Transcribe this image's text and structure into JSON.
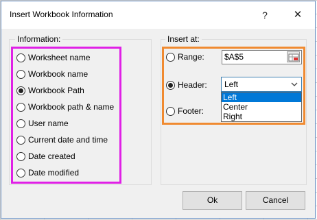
{
  "dialog": {
    "title": "Insert Workbook Information",
    "help_label": "?",
    "close_label": "✕"
  },
  "information": {
    "caption": "Information:",
    "options": [
      {
        "label": "Worksheet name",
        "checked": false
      },
      {
        "label": "Workbook name",
        "checked": false
      },
      {
        "label": "Workbook Path",
        "checked": true
      },
      {
        "label": "Workbook path & name",
        "checked": false
      },
      {
        "label": "User name",
        "checked": false
      },
      {
        "label": "Current date and time",
        "checked": false
      },
      {
        "label": "Date created",
        "checked": false
      },
      {
        "label": "Date modified",
        "checked": false
      }
    ]
  },
  "insert_at": {
    "caption": "Insert at:",
    "range": {
      "label": "Range:",
      "value": "$A$5",
      "checked": false
    },
    "header": {
      "label": "Header:",
      "checked": true,
      "selected": "Left",
      "options": [
        "Left",
        "Center",
        "Right"
      ]
    },
    "footer": {
      "label": "Footer:",
      "checked": false
    }
  },
  "buttons": {
    "ok": "Ok",
    "cancel": "Cancel"
  },
  "colors": {
    "info_highlight": "#e020e6",
    "insert_highlight": "#f08a30",
    "selection": "#0078d7"
  }
}
